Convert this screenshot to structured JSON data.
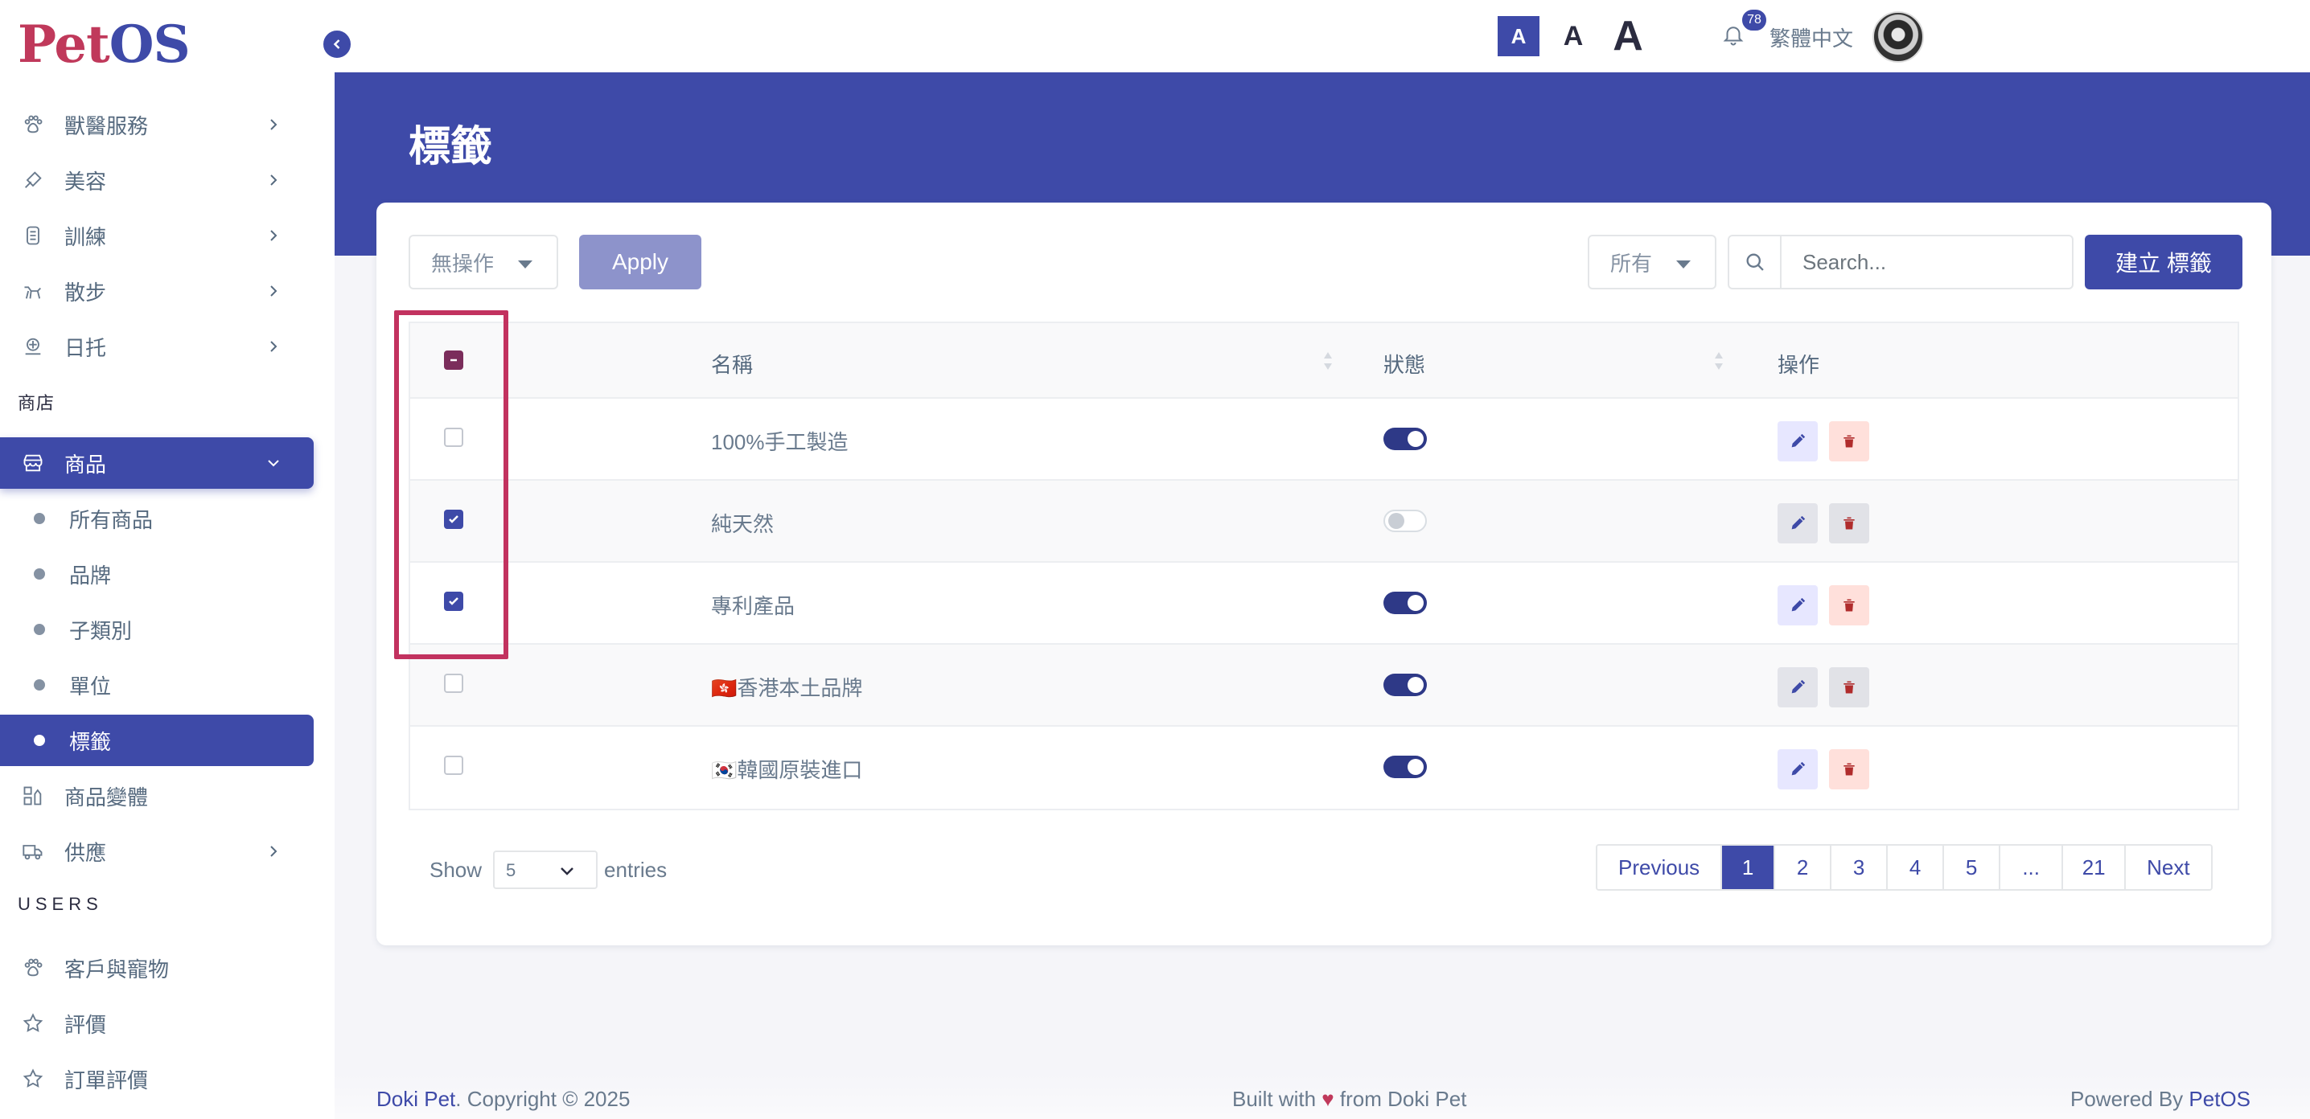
{
  "brand": {
    "logo_part1": "Pet",
    "logo_part2": "OS"
  },
  "sidebar": {
    "items": [
      {
        "label": "獸醫服務",
        "icon": "paw-icon"
      },
      {
        "label": "美容",
        "icon": "brush-icon"
      },
      {
        "label": "訓練",
        "icon": "medal-icon"
      },
      {
        "label": "散步",
        "icon": "walk-icon"
      },
      {
        "label": "日托",
        "icon": "daycare-icon"
      }
    ],
    "section_shop": "商店",
    "products": {
      "label": "商品",
      "icon": "store-icon"
    },
    "product_sub": [
      "所有商品",
      "品牌",
      "子類別",
      "單位",
      "標籤"
    ],
    "variants": {
      "label": "商品變體",
      "icon": "variants-icon"
    },
    "supply": {
      "label": "供應",
      "icon": "truck-icon"
    },
    "section_users": "USERS",
    "customers": {
      "label": "客戶與寵物",
      "icon": "paw-icon"
    },
    "reviews": {
      "label": "評價",
      "icon": "star-icon"
    },
    "order_reviews": {
      "label": "訂單評價",
      "icon": "star-icon"
    }
  },
  "topbar": {
    "font_small": "A",
    "font_medium": "A",
    "font_large": "A",
    "notification_count": "78",
    "language": "繁體中文"
  },
  "page": {
    "title": "標籤"
  },
  "toolbar": {
    "bulk_action": "無操作",
    "apply_label": "Apply",
    "filter": "所有",
    "search_placeholder": "Search...",
    "create_label": "建立 標籤"
  },
  "table": {
    "headers": {
      "name": "名稱",
      "status": "狀態",
      "actions": "操作"
    },
    "rows": [
      {
        "name": "100%手工製造",
        "checked": false,
        "status": true
      },
      {
        "name": "純天然",
        "checked": true,
        "status": false
      },
      {
        "name": "專利產品",
        "checked": true,
        "status": true
      },
      {
        "name": "🇭🇰香港本土品牌",
        "checked": false,
        "status": true
      },
      {
        "name": "🇰🇷韓國原裝進口",
        "checked": false,
        "status": true
      }
    ]
  },
  "pagination": {
    "show_label": "Show",
    "page_length": "5",
    "entries_label": "entries",
    "previous": "Previous",
    "pages": [
      "1",
      "2",
      "3",
      "4",
      "5",
      "...",
      "21"
    ],
    "next": "Next",
    "current": "1"
  },
  "footer": {
    "brand": "Doki Pet",
    "copyright": ". Copyright © 2025",
    "built_prefix": "Built with ",
    "heart": "♥",
    "built_suffix": " from Doki Pet",
    "powered_prefix": "Powered By ",
    "powered_brand": "PetOS"
  },
  "colors": {
    "primary": "#3e4aa8",
    "brand_red": "#c0395b",
    "highlight": "#c2325f"
  }
}
